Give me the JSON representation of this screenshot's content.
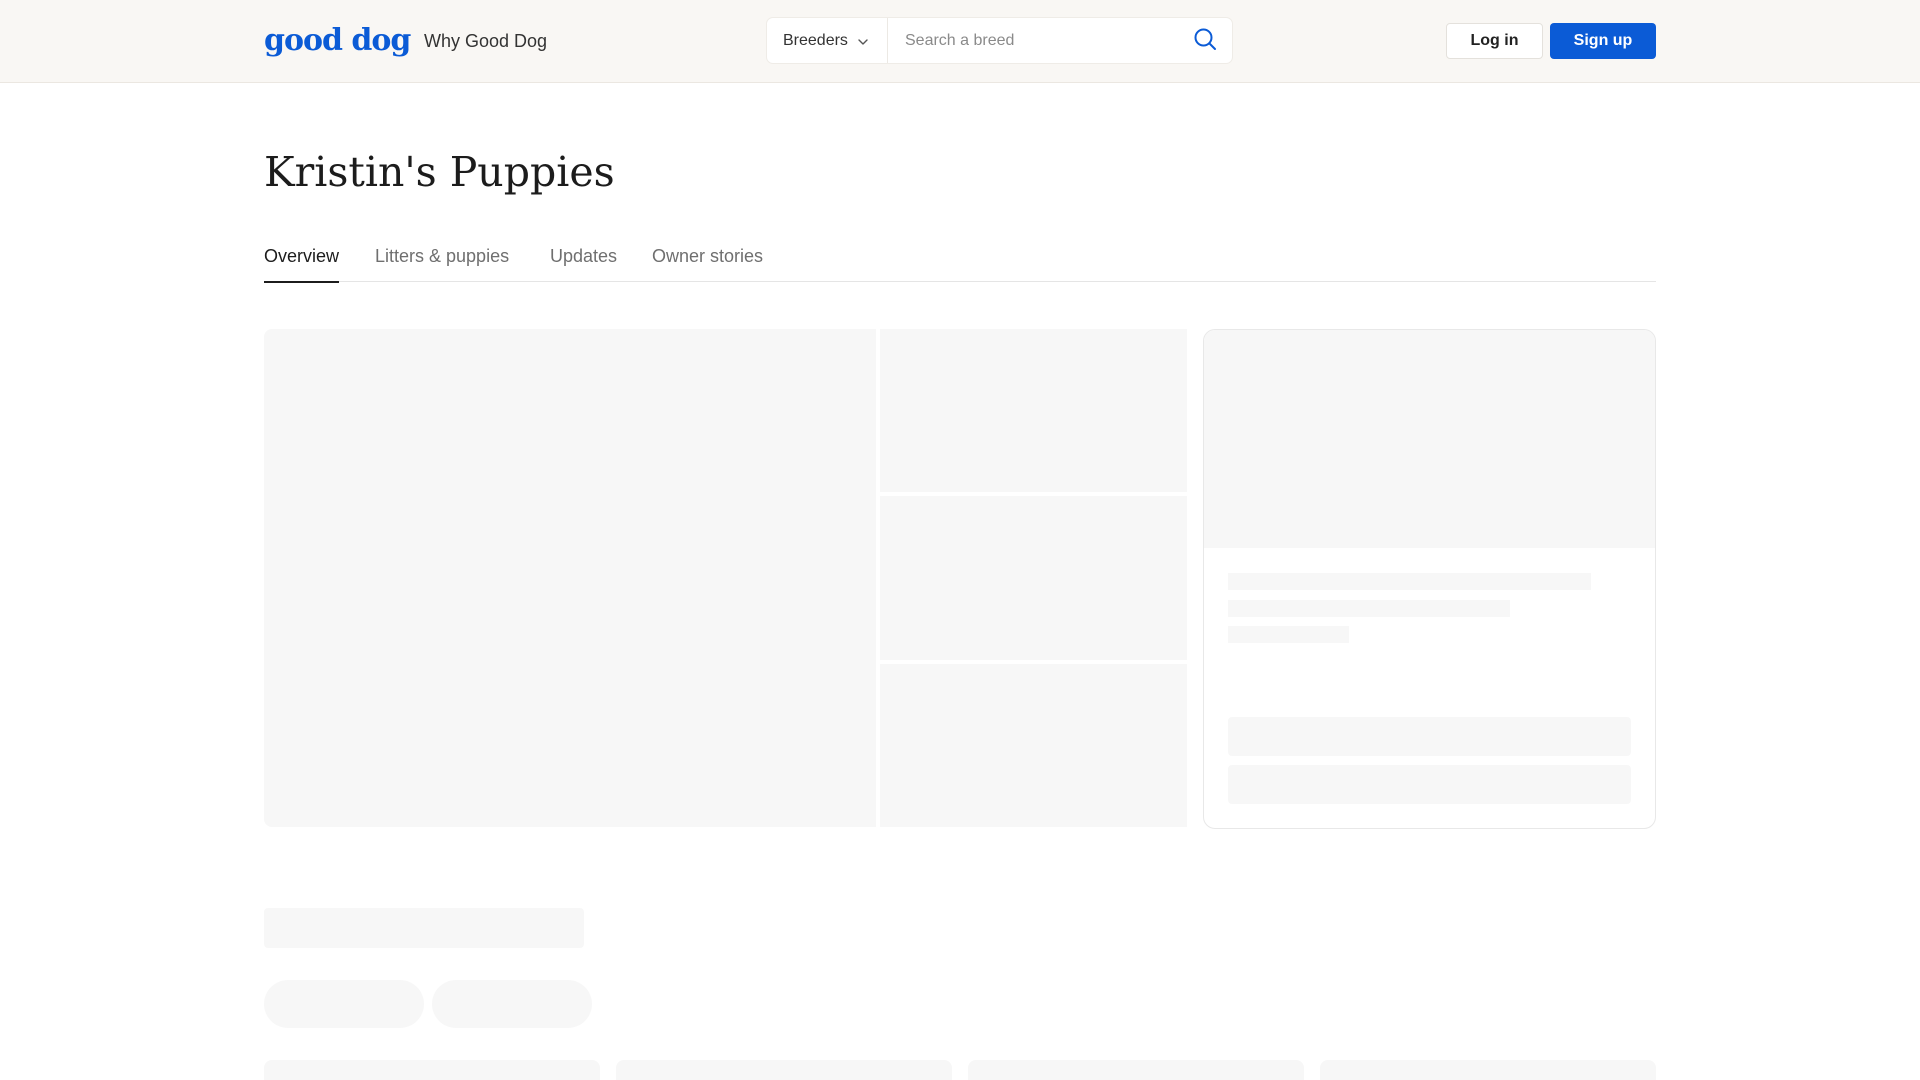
{
  "header": {
    "logo_text": "good dog",
    "nav_why": "Why Good Dog",
    "search": {
      "category": "Breeders",
      "placeholder": "Search a breed"
    },
    "login_label": "Log in",
    "signup_label": "Sign up"
  },
  "page": {
    "title": "Kristin's Puppies"
  },
  "tabs": [
    {
      "label": "Overview",
      "active": true
    },
    {
      "label": "Litters & puppies",
      "active": false
    },
    {
      "label": "Updates",
      "active": false
    },
    {
      "label": "Owner stories",
      "active": false
    }
  ],
  "colors": {
    "brand": "#0b5bd6",
    "header_bg": "#f9f7f4",
    "skeleton": "#f7f7f7"
  },
  "icons": {
    "search": "search-icon",
    "chevron": "chevron-down-icon"
  }
}
